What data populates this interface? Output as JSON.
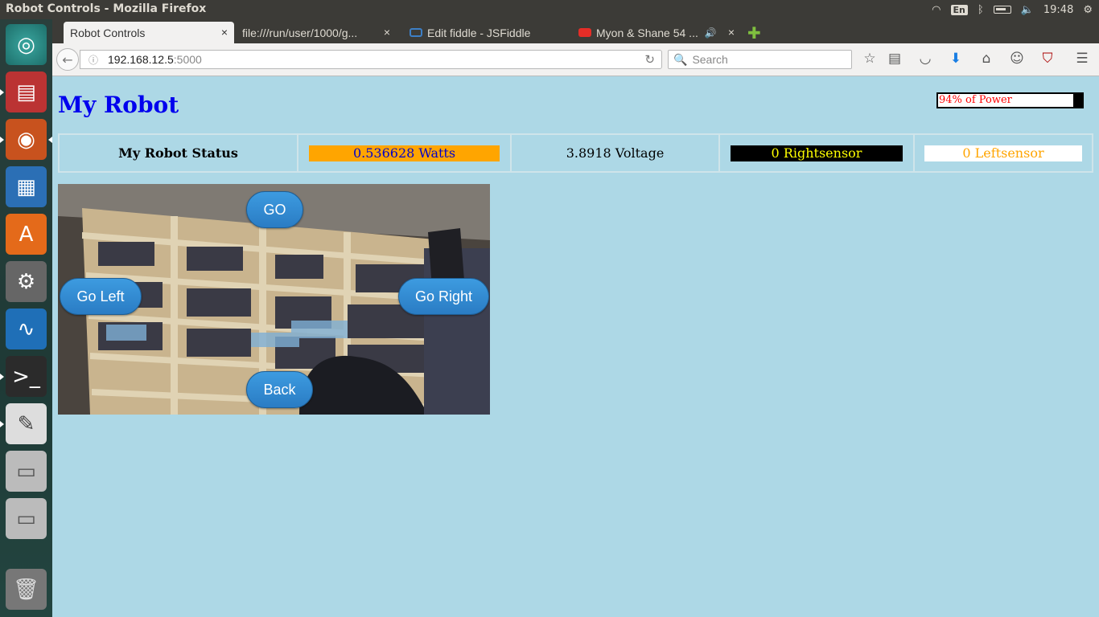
{
  "window_title": "Robot Controls - Mozilla Firefox",
  "tray": {
    "lang": "En",
    "time": "19:48"
  },
  "tabs": [
    {
      "label": "Robot Controls",
      "close": "×"
    },
    {
      "label": "file:///run/user/1000/g...",
      "close": "×"
    },
    {
      "label": "Edit fiddle - JSFiddle",
      "close": "×"
    },
    {
      "label": "Myon & Shane 54 ...",
      "close": "×"
    }
  ],
  "new_tab": "✚",
  "url": {
    "host": "192.168.12.5",
    "port": ":5000"
  },
  "search": {
    "placeholder": "Search"
  },
  "page": {
    "title": "My Robot",
    "power": {
      "label": "94% of Power",
      "level": 0.94
    },
    "status": {
      "header": "My Robot Status",
      "watts": "0.536628 Watts",
      "voltage": "3.8918 Voltage",
      "right": "0 Rightsensor",
      "left": "0 Leftsensor"
    },
    "buttons": {
      "go": "GO",
      "left": "Go Left",
      "right": "Go Right",
      "back": "Back"
    }
  },
  "colors": {
    "page_bg": "#add8e6",
    "title": "#0000ee",
    "watts_bg": "#ffa500",
    "watts_fg": "#0000cc",
    "right_bg": "#000000",
    "right_fg": "#ffff00",
    "left_bg": "#ffffff",
    "left_fg": "#ffa500"
  }
}
